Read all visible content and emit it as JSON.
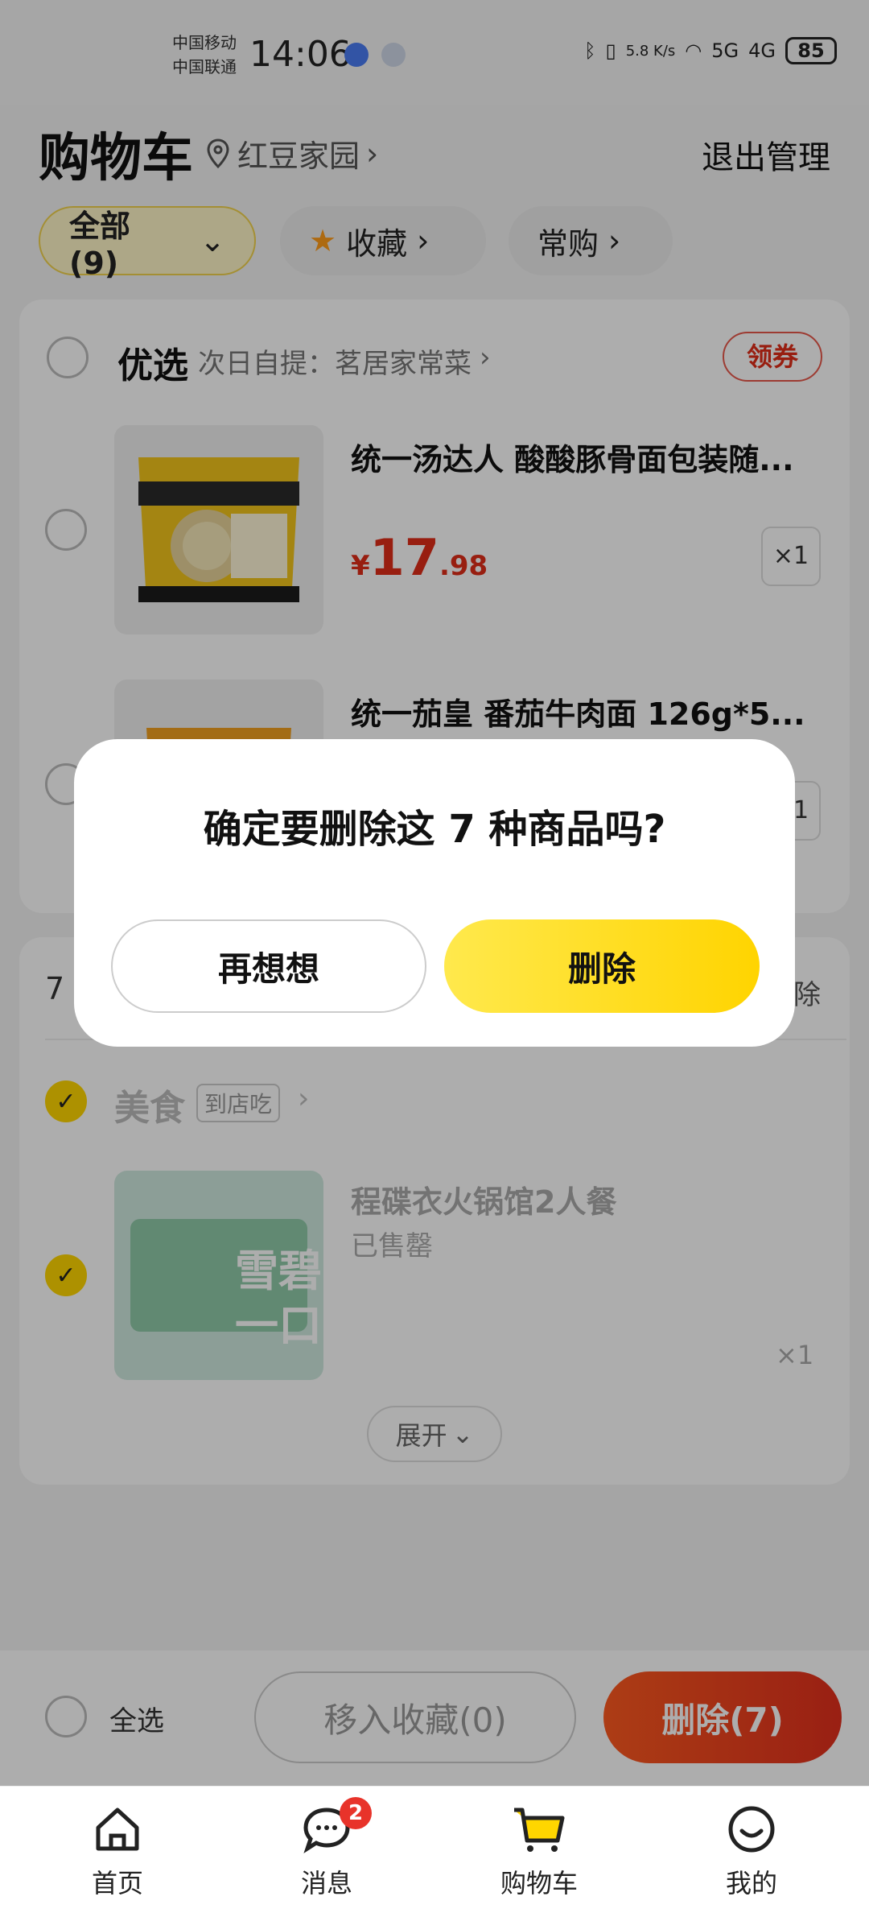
{
  "status_bar": {
    "carrier1": "中国移动",
    "carrier2": "中国联通",
    "time": "14:06",
    "net_speed": "5.8 K/s",
    "signal1": "5G",
    "signal2": "4G",
    "battery": "85"
  },
  "header": {
    "title": "购物车",
    "location": "红豆家园",
    "manage": "退出管理"
  },
  "filters": [
    {
      "label": "全部 (9)"
    },
    {
      "label": "收藏"
    },
    {
      "label": "常购"
    }
  ],
  "section1": {
    "name": "优选",
    "subtitle": "次日自提：茗居家常菜",
    "coupon": "领券",
    "items": [
      {
        "title": "统一汤达人 酸酸豚骨面包装随...",
        "price_symbol": "¥",
        "price_int": "17",
        "price_dec": ".98",
        "qty": "×1"
      },
      {
        "title": "统一茄皇 番茄牛肉面 126g*5...",
        "qty": "×1"
      }
    ]
  },
  "section2": {
    "count_prefix": "7",
    "delete_hint": "除",
    "category": "美食",
    "category_tag": "到店吃",
    "item": {
      "title": "程碟衣火锅馆2人餐",
      "status": "已售罄",
      "img_text1": "雪碧",
      "img_text2": "一口",
      "qty": "×1"
    },
    "expand": "展开"
  },
  "dialog": {
    "message": "确定要删除这 7 种商品吗?",
    "cancel": "再想想",
    "confirm": "删除"
  },
  "action_bar": {
    "select_all": "全选",
    "move_to_fav": "移入收藏(0)",
    "delete": "删除(7)"
  },
  "tabbar": [
    {
      "label": "首页"
    },
    {
      "label": "消息",
      "badge": "2"
    },
    {
      "label": "购物车"
    },
    {
      "label": "我的"
    }
  ]
}
